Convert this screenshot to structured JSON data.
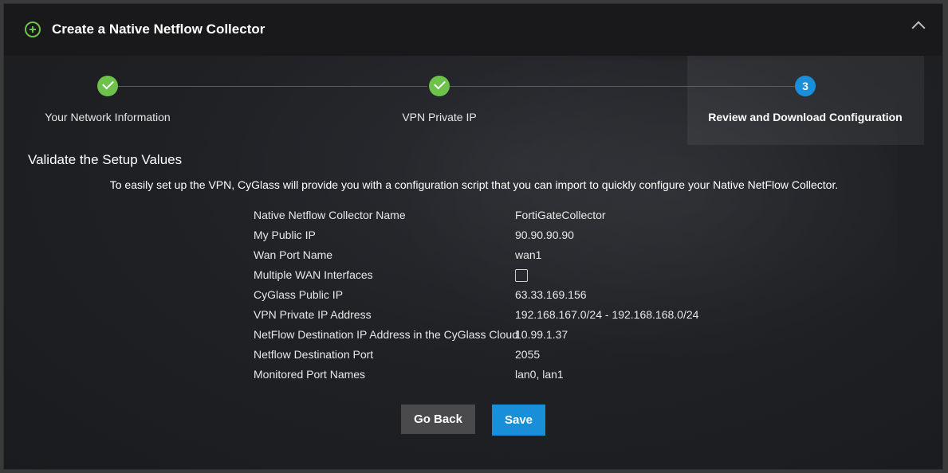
{
  "header": {
    "title": "Create a Native Netflow Collector"
  },
  "wizard": {
    "steps": [
      {
        "label": "Your Network Information",
        "status": "done",
        "marker": ""
      },
      {
        "label": "VPN Private IP",
        "status": "done",
        "marker": ""
      },
      {
        "label": "Review and Download Configuration",
        "status": "current",
        "marker": "3"
      }
    ]
  },
  "section": {
    "title": "Validate the Setup Values",
    "intro": "To easily set up the VPN, CyGlass will provide you with a configuration script that you can import to quickly configure your Native NetFlow Collector."
  },
  "fields": [
    {
      "label": "Native Netflow Collector Name",
      "value": "FortiGateCollector"
    },
    {
      "label": "My Public IP",
      "value": "90.90.90.90"
    },
    {
      "label": "Wan Port Name",
      "value": "wan1"
    },
    {
      "label": "Multiple WAN Interfaces",
      "value": "",
      "checkbox": false
    },
    {
      "label": "CyGlass Public IP",
      "value": "63.33.169.156"
    },
    {
      "label": "VPN Private IP Address",
      "value": "192.168.167.0/24 - 192.168.168.0/24"
    },
    {
      "label": "NetFlow Destination IP Address in the CyGlass Cloud",
      "value": "10.99.1.37"
    },
    {
      "label": "Netflow Destination Port",
      "value": "2055"
    },
    {
      "label": "Monitored Port Names",
      "value": "lan0, lan1"
    }
  ],
  "buttons": {
    "back_label": "Go Back",
    "save_label": "Save"
  },
  "colors": {
    "accent_blue": "#1a8fd9",
    "success_green": "#6cc24a",
    "background": "#1f2125"
  }
}
